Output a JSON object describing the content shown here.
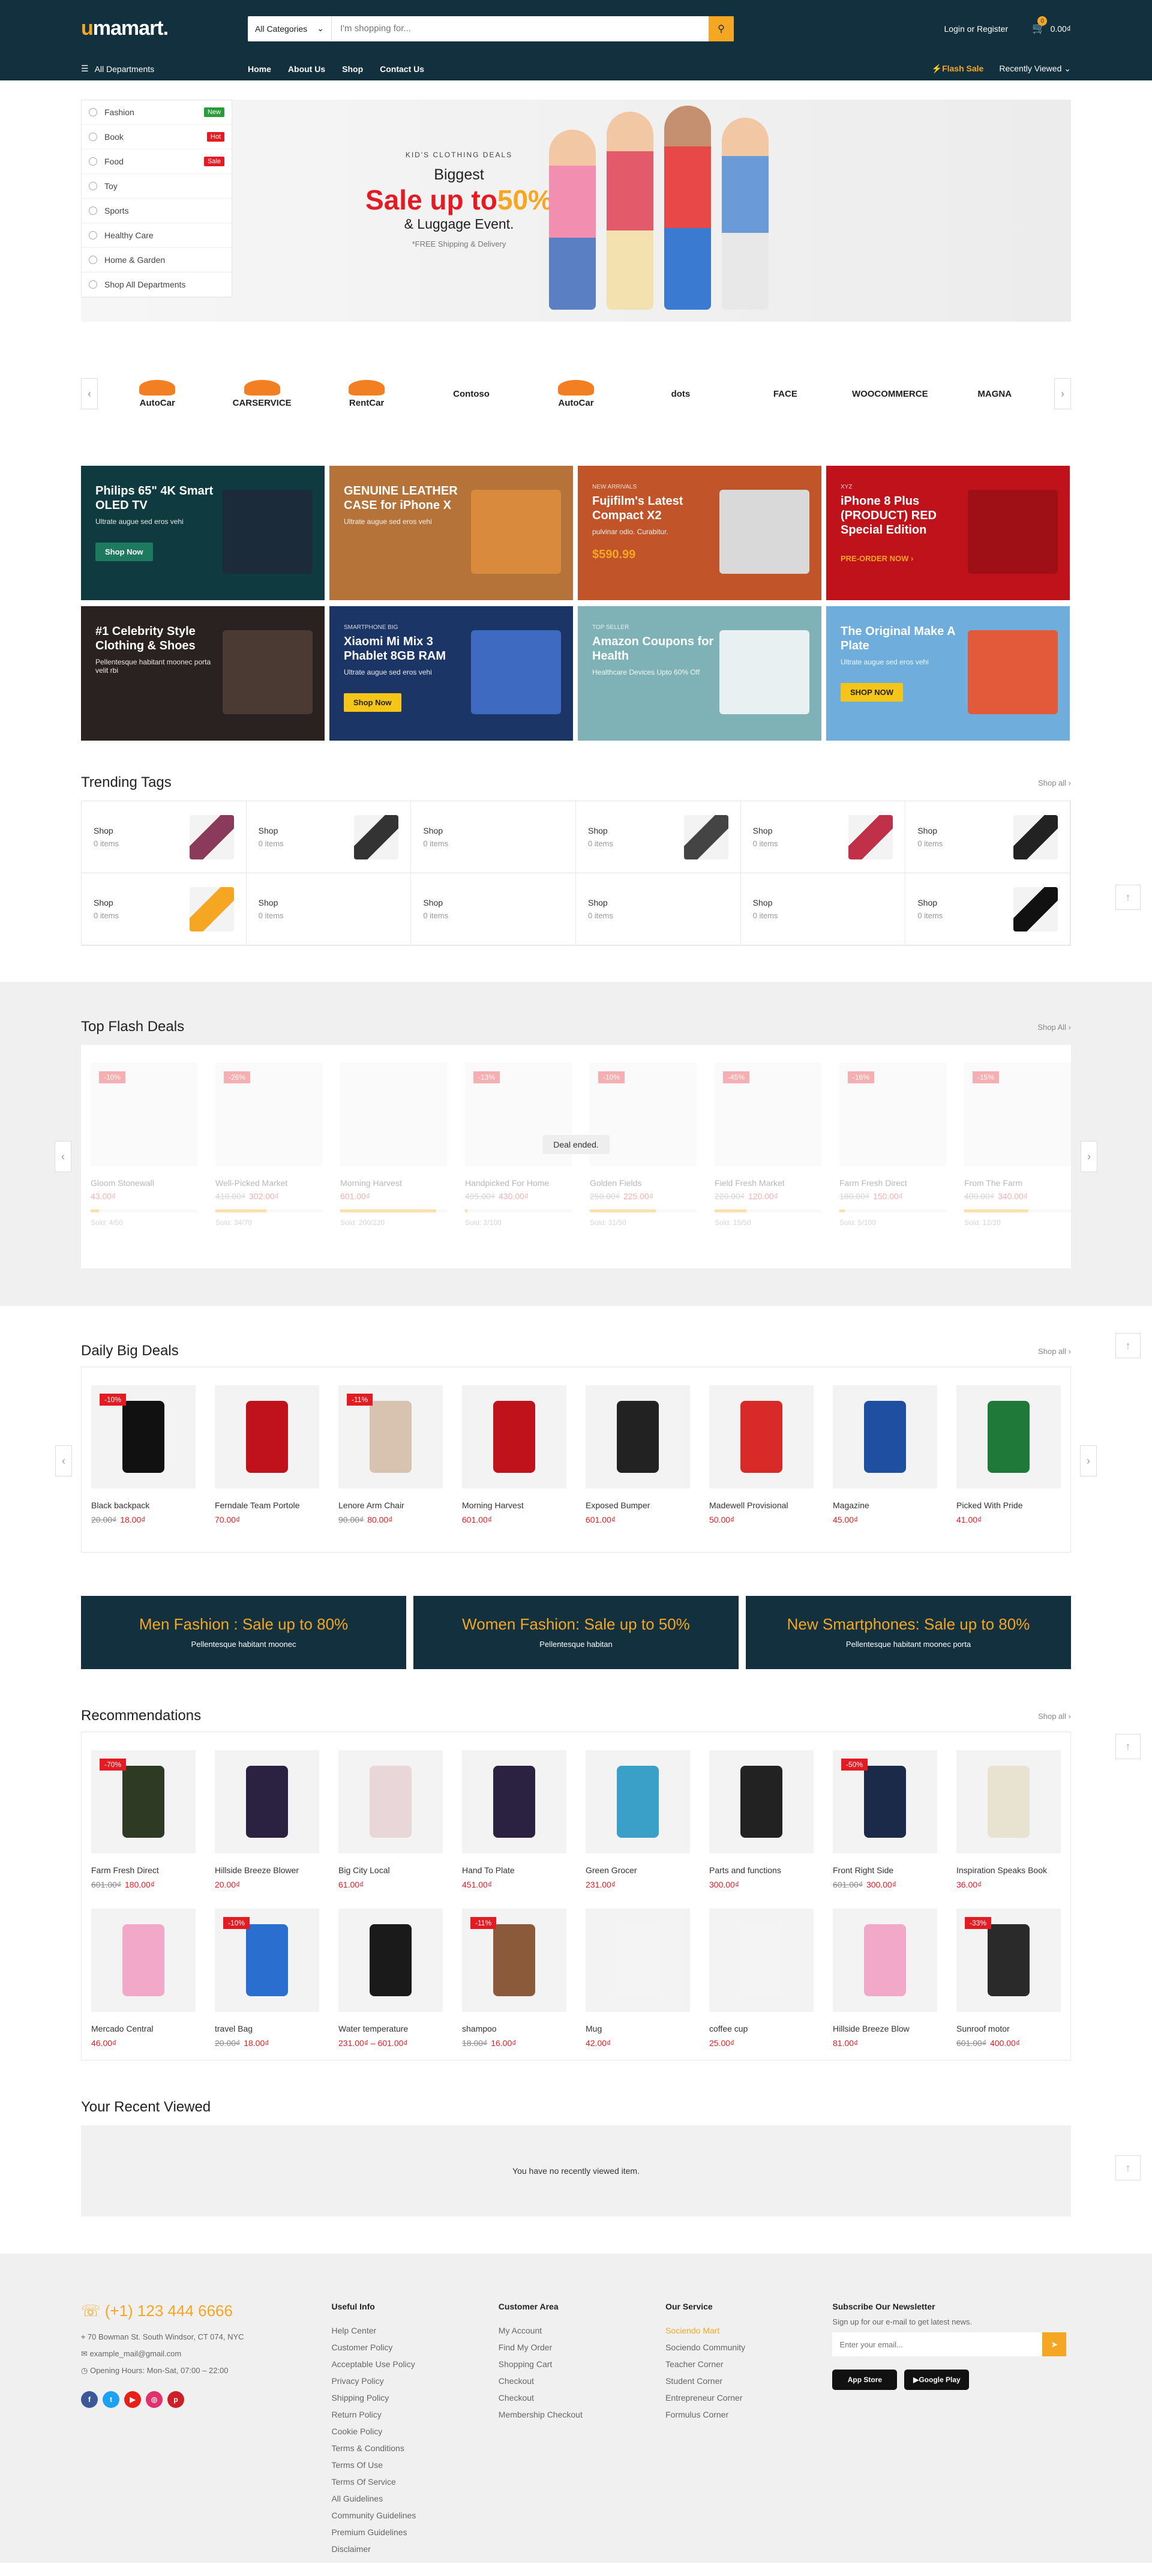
{
  "header": {
    "logo": {
      "u": "u",
      "rest": "mamart."
    },
    "search": {
      "category": "All Categories",
      "placeholder": "I'm shopping for..."
    },
    "login": "Login or Register",
    "cart_count": "0",
    "cart_total": "0.00₫",
    "all_departments": "All Departments",
    "nav": [
      "Home",
      "About Us",
      "Shop",
      "Contact Us"
    ],
    "flash_sale": "Flash Sale",
    "recently_viewed": "Recently Viewed"
  },
  "departments": [
    {
      "label": "Fashion",
      "badge": "New",
      "badge_color": "#2a9d3a"
    },
    {
      "label": "Book",
      "badge": "Hot",
      "badge_color": "#e31b23"
    },
    {
      "label": "Food",
      "badge": "Sale",
      "badge_color": "#e31b23"
    },
    {
      "label": "Toy"
    },
    {
      "label": "Sports"
    },
    {
      "label": "Healthy Care"
    },
    {
      "label": "Home & Garden"
    },
    {
      "label": "Shop All Departments"
    }
  ],
  "hero": {
    "kicker": "KID'S CLOTHING DEALS",
    "line1": "Biggest",
    "sale": "Sale up to",
    "percent": "50%",
    "line3": "& Luggage Event.",
    "shipping": "*FREE Shipping & Delivery"
  },
  "brands": [
    "AutoCar",
    "CARSERVICE",
    "RentCar",
    "Contoso",
    "AutoCar",
    "dots",
    "FACE",
    "WOOCOMMERCE",
    "MAGNA"
  ],
  "promos": [
    {
      "label": "",
      "title": "Philips 65\" 4K Smart OLED TV",
      "sub": "Ultrate augue sed eros vehi",
      "btn": "Shop Now",
      "price": "",
      "bg": "#0f3a3f",
      "btnbg": "#1e7a5f",
      "btncolor": "#fff",
      "img": "#1b2b3a"
    },
    {
      "label": "",
      "title": "GENUINE LEATHER CASE for iPhone X",
      "sub": "Ultrate augue sed eros vehi",
      "btn": "",
      "price": "",
      "bg": "#b5733a",
      "btnbg": "",
      "btncolor": "",
      "img": "#d98a3d"
    },
    {
      "label": "NEW ARRIVALS",
      "title": "Fujifilm's Latest Compact X2",
      "sub": "pulvinar odio. Curabitur.",
      "btn": "",
      "price": "$590.99",
      "bg": "#c2542a",
      "btnbg": "",
      "btncolor": "",
      "img": "#d9d9d9"
    },
    {
      "label": "XYZ",
      "title": "iPhone 8 Plus (PRODUCT) RED Special Edition",
      "sub": "",
      "btn": "PRE-ORDER NOW ›",
      "price": "",
      "bg": "#c0121b",
      "btnbg": "transparent",
      "btncolor": "#f5a623",
      "img": "#9e0f16"
    },
    {
      "label": "",
      "title": "#1 Celebrity Style Clothing & Shoes",
      "sub": "Pellentesque habitant moonec porta velit rbi",
      "btn": "",
      "price": "",
      "bg": "#2a2220",
      "btnbg": "",
      "btncolor": "",
      "img": "#4a3a33"
    },
    {
      "label": "SMARTPHONE BIG",
      "title": "Xiaomi Mi Mix 3 Phablet 8GB RAM",
      "sub": "Ultrate augue sed eros vehi",
      "btn": "Shop Now",
      "price": "",
      "bg": "#1b3566",
      "btnbg": "#f5c518",
      "btncolor": "#222",
      "img": "#3e6ac2"
    },
    {
      "label": "TOP SELLER",
      "title": "Amazon Coupons for Health",
      "sub": "Healthcare Devices Upto 60% Off",
      "btn": "",
      "price": "",
      "bg": "#7fb2b6",
      "btnbg": "",
      "btncolor": "",
      "img": "#e8f0f2"
    },
    {
      "label": "",
      "title": "The Original Make A Plate",
      "sub": "Ultrate augue sed eros vehi",
      "btn": "SHOP NOW",
      "price": "",
      "bg": "#6faedc",
      "btnbg": "#f5c518",
      "btncolor": "#222",
      "img": "#e35a3a"
    }
  ],
  "trending": {
    "title": "Trending Tags",
    "shop_all": "Shop all ›",
    "tags": [
      {
        "name": "Shop",
        "count": "0 items",
        "img": "#8a3a5a"
      },
      {
        "name": "Shop",
        "count": "0 items",
        "img": "#333"
      },
      {
        "name": "Shop",
        "count": "0 items",
        "img": ""
      },
      {
        "name": "Shop",
        "count": "0 items",
        "img": "#444"
      },
      {
        "name": "Shop",
        "count": "0 items",
        "img": "#c03048"
      },
      {
        "name": "Shop",
        "count": "0 items",
        "img": "#222"
      },
      {
        "name": "Shop",
        "count": "0 items",
        "img": "#f5a623"
      },
      {
        "name": "Shop",
        "count": "0 items",
        "img": ""
      },
      {
        "name": "Shop",
        "count": "0 items",
        "img": ""
      },
      {
        "name": "Shop",
        "count": "0 items",
        "img": ""
      },
      {
        "name": "Shop",
        "count": "0 items",
        "img": ""
      },
      {
        "name": "Shop",
        "count": "0 items",
        "img": "#111"
      }
    ]
  },
  "flash": {
    "title": "Top Flash Deals",
    "shop_all": "Shop All ›",
    "deal_ended": "Deal ended.",
    "items": [
      {
        "disc": "-10%",
        "name": "Gloom Stonewall",
        "old": "",
        "price": "43.00₫",
        "sold": "Sold: 4/50",
        "pct": 8
      },
      {
        "disc": "-26%",
        "name": "Well-Picked Market",
        "old": "410.00₫",
        "price": "302.00₫",
        "sold": "Sold: 34/70",
        "pct": 48
      },
      {
        "disc": "",
        "name": "Morning Harvest",
        "old": "",
        "price": "601.00₫",
        "sold": "Sold: 200/220",
        "pct": 90
      },
      {
        "disc": "-13%",
        "name": "Handpicked For Home",
        "old": "495.00₫",
        "price": "430.00₫",
        "sold": "Sold: 2/100",
        "pct": 2
      },
      {
        "disc": "-10%",
        "name": "Golden Fields",
        "old": "250.00₫",
        "price": "225.00₫",
        "sold": "Sold: 31/50",
        "pct": 62
      },
      {
        "disc": "-45%",
        "name": "Field Fresh Market",
        "old": "220.00₫",
        "price": "120.00₫",
        "sold": "Sold: 15/50",
        "pct": 30
      },
      {
        "disc": "-16%",
        "name": "Farm Fresh Direct",
        "old": "180.00₫",
        "price": "150.00₫",
        "sold": "Sold: 5/100",
        "pct": 5
      },
      {
        "disc": "-15%",
        "name": "From The Farm",
        "old": "400.00₫",
        "price": "340.00₫",
        "sold": "Sold: 12/20",
        "pct": 60
      }
    ]
  },
  "daily": {
    "title": "Daily Big Deals",
    "shop_all": "Shop all ›",
    "items": [
      {
        "disc": "-10%",
        "name": "Black backpack",
        "old": "20.00₫",
        "price": "18.00₫",
        "img": "#111"
      },
      {
        "disc": "",
        "name": "Ferndale Team Portole",
        "old": "",
        "price": "70.00₫",
        "img": "#c0121b"
      },
      {
        "disc": "-11%",
        "name": "Lenore Arm Chair",
        "old": "90.00₫",
        "price": "80.00₫",
        "img": "#d8c2b0"
      },
      {
        "disc": "",
        "name": "Morning Harvest",
        "old": "",
        "price": "601.00₫",
        "img": "#c0121b"
      },
      {
        "disc": "",
        "name": "Exposed Bumper",
        "old": "",
        "price": "601.00₫",
        "img": "#222"
      },
      {
        "disc": "",
        "name": "Madewell Provisional",
        "old": "",
        "price": "50.00₫",
        "img": "#d92a2a"
      },
      {
        "disc": "",
        "name": "Magazine",
        "old": "",
        "price": "45.00₫",
        "img": "#1e4fa0"
      },
      {
        "disc": "",
        "name": "Picked With Pride",
        "old": "",
        "price": "41.00₫",
        "img": "#1f7a3a"
      }
    ]
  },
  "fashion_banners": [
    {
      "label": "Men Fashion : ",
      "hl": "Sale up to 80%",
      "sub": "Pellentesque habitant moonec"
    },
    {
      "label": "Women Fashion: ",
      "hl": "Sale up to 50%",
      "sub": "Pellentesque habitan"
    },
    {
      "label": "New Smartphones: ",
      "hl": "Sale up to 80%",
      "sub": "Pellentesque habitant moonec porta"
    }
  ],
  "recs": {
    "title": "Recommendations",
    "shop_all": "Shop all ›",
    "row1": [
      {
        "disc": "-70%",
        "name": "Farm Fresh Direct",
        "old": "601.00₫",
        "price": "180.00₫",
        "img": "#2f3a24"
      },
      {
        "disc": "",
        "name": "Hillside Breeze Blower",
        "old": "",
        "price": "20.00₫",
        "img": "#2a2240"
      },
      {
        "disc": "",
        "name": "Big City Local",
        "old": "",
        "price": "61.00₫",
        "img": "#e9d6d8"
      },
      {
        "disc": "",
        "name": "Hand To Plate",
        "old": "",
        "price": "451.00₫",
        "img": "#2a2240"
      },
      {
        "disc": "",
        "name": "Green Grocer",
        "old": "",
        "price": "231.00₫",
        "img": "#3aa0c8"
      },
      {
        "disc": "",
        "name": "Parts and functions",
        "old": "",
        "price": "300.00₫",
        "img": "#222"
      },
      {
        "disc": "-50%",
        "name": "Front Right Side",
        "old": "601.00₫",
        "price": "300.00₫",
        "img": "#1b2a48"
      },
      {
        "disc": "",
        "name": "Inspiration Speaks Book",
        "old": "",
        "price": "36.00₫",
        "img": "#e8e2d0"
      }
    ],
    "row2": [
      {
        "disc": "",
        "name": "Mercado Central",
        "old": "",
        "price": "46.00₫",
        "img": "#f2a8c8"
      },
      {
        "disc": "-10%",
        "name": "travel Bag",
        "old": "20.00₫",
        "price": "18.00₫",
        "img": "#2a6fd0"
      },
      {
        "disc": "",
        "name": "Water temperature",
        "old": "",
        "price": "231.00₫ – 601.00₫",
        "img": "#1a1a1a"
      },
      {
        "disc": "-11%",
        "name": "shampoo",
        "old": "18.00₫",
        "price": "16.00₫",
        "img": "#8a5a3a"
      },
      {
        "disc": "",
        "name": "Mug",
        "old": "",
        "price": "42.00₫",
        "img": "#f4f4f4"
      },
      {
        "disc": "",
        "name": "coffee cup",
        "old": "",
        "price": "25.00₫",
        "img": "#f4f4f4"
      },
      {
        "disc": "",
        "name": "Hillside Breeze Blow",
        "old": "",
        "price": "81.00₫",
        "img": "#f2a8c8"
      },
      {
        "disc": "-33%",
        "name": "Sunroof motor",
        "old": "601.00₫",
        "price": "400.00₫",
        "img": "#2a2a2a"
      }
    ]
  },
  "recent": {
    "title": "Your Recent Viewed",
    "empty": "You have no recently viewed item."
  },
  "footer": {
    "phone": "(+1) 123 444 6666",
    "address": "70 Bowman St. South Windsor, CT 074, NYC",
    "email": "example_mail@gmail.com",
    "hours": "Opening Hours: Mon-Sat, 07:00 – 22:00",
    "useful_title": "Useful Info",
    "useful": [
      "Help Center",
      "Customer Policy",
      "Acceptable Use Policy",
      "Privacy Policy",
      "Shipping Policy",
      "Return Policy",
      "Cookie Policy",
      "Terms & Conditions",
      "Terms Of Use",
      "Terms Of Service",
      "All Guidelines",
      "Community Guidelines",
      "Premium Guidelines",
      "Disclaimer"
    ],
    "customer_title": "Customer Area",
    "customer": [
      "My Account",
      "Find My Order",
      "Shopping Cart",
      "Checkout",
      "Checkout",
      "Membership Checkout"
    ],
    "service_title": "Our Service",
    "service": [
      "Sociendo Mart",
      "Sociendo Community",
      "Teacher Corner",
      "Student Corner",
      "Entrepreneur Corner",
      "Formulus Corner"
    ],
    "newsletter_title": "Subscribe Our Newsletter",
    "newsletter_sub": "Sign up for our e-mail to get latest news.",
    "newsletter_placeholder": "Enter your email...",
    "app_store": "App Store",
    "google_play": "Google Play"
  }
}
